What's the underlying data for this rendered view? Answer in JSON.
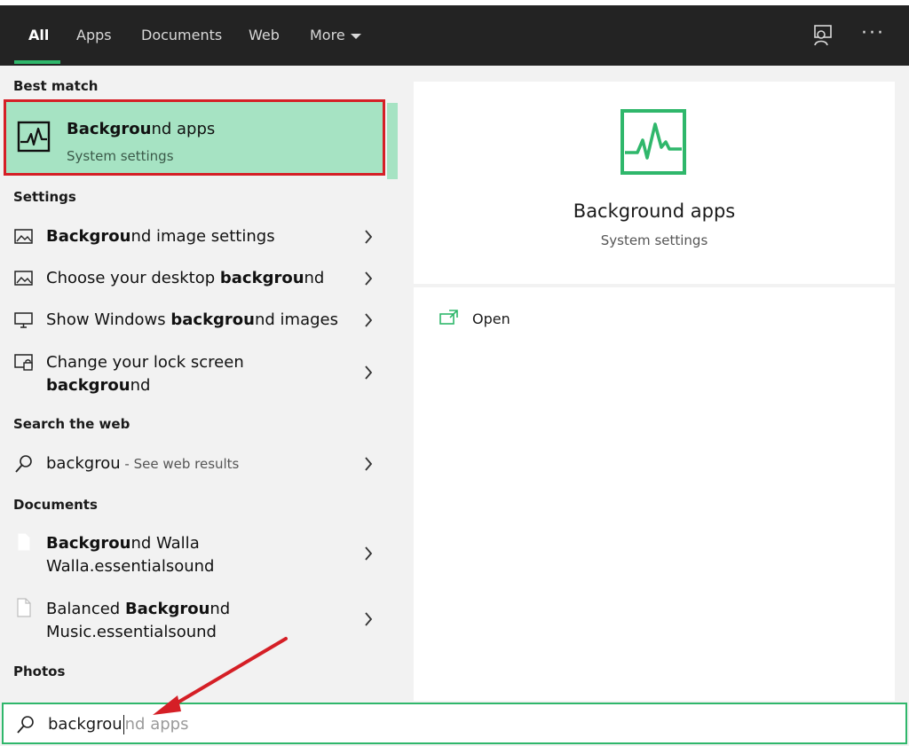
{
  "header": {
    "tabs": [
      {
        "label": "All",
        "active": true
      },
      {
        "label": "Apps"
      },
      {
        "label": "Documents"
      },
      {
        "label": "Web"
      },
      {
        "label": "More"
      }
    ],
    "icons": [
      "feedback-icon",
      "more-options-icon"
    ],
    "accent": "#2fb76b"
  },
  "best_match": {
    "section": "Best match",
    "title_bold": "Backgrou",
    "title_rest": "nd apps",
    "subtitle": "System settings",
    "icon": "activity-monitor-icon"
  },
  "settings": {
    "section": "Settings",
    "items": [
      {
        "pre": "",
        "bold": "Backgrou",
        "post": "nd image settings",
        "icon": "image-icon"
      },
      {
        "pre": "Choose your desktop ",
        "bold": "backgrou",
        "post": "nd",
        "icon": "image-icon"
      },
      {
        "pre": "Show Windows ",
        "bold": "backgrou",
        "post": "nd images",
        "icon": "monitor-icon"
      },
      {
        "line1": "Change your lock screen",
        "bold": "backgrou",
        "post": "nd",
        "icon": "lock-screen-icon"
      }
    ]
  },
  "web": {
    "section": "Search the web",
    "query": "backgrou",
    "suffix": " - See web results",
    "icon": "search-icon"
  },
  "documents": {
    "section": "Documents",
    "items": [
      {
        "bold": "Backgrou",
        "post": "nd Walla",
        "line2": "Walla.essentialsound",
        "icon": "document-icon"
      },
      {
        "pre": "Balanced ",
        "bold": "Backgrou",
        "post": "nd",
        "line2": "Music.essentialsound",
        "icon": "document-icon"
      }
    ]
  },
  "photos": {
    "section": "Photos"
  },
  "preview": {
    "title": "Background apps",
    "subtitle": "System settings",
    "action_open": "Open",
    "icon": "activity-monitor-icon"
  },
  "search": {
    "typed": "backgrou",
    "suggestion": "nd apps",
    "icon": "search-icon"
  },
  "colors": {
    "highlight": "#a6e3c3",
    "annotation_red": "#d51f26",
    "header_bg": "#232323"
  }
}
